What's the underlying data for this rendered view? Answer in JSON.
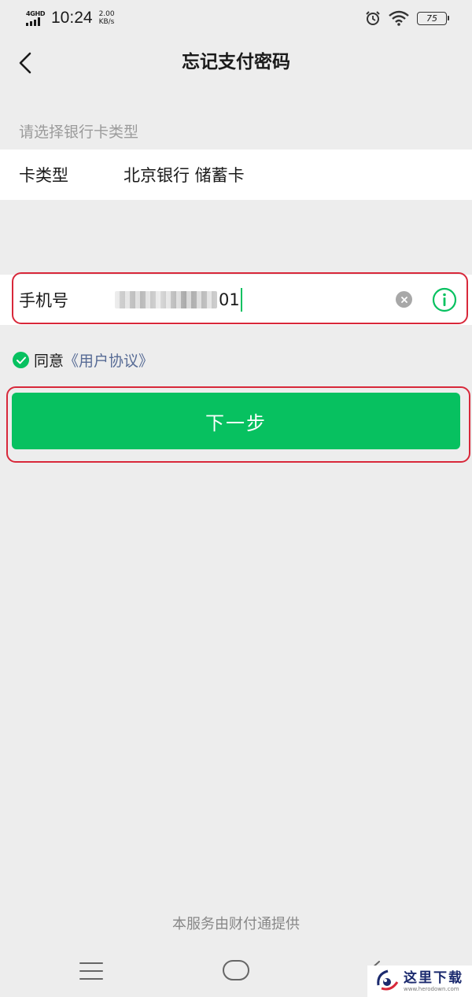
{
  "status_bar": {
    "network_type": "4GHD",
    "time": "10:24",
    "speed_value": "2.00",
    "speed_unit": "KB/s",
    "battery": "75",
    "icons": [
      "alarm-icon",
      "wifi-icon",
      "battery-icon"
    ]
  },
  "nav": {
    "title": "忘记支付密码",
    "back_icon": "chevron-left-icon"
  },
  "form": {
    "section_label": "请选择银行卡类型",
    "card_type": {
      "label": "卡类型",
      "value": "北京银行 储蓄卡"
    },
    "phone": {
      "label": "手机号",
      "value_visible_suffix": "01",
      "clear_icon": "clear-icon",
      "info_icon": "info-icon"
    }
  },
  "agreement": {
    "prefix": "同意",
    "link": "《用户协议》"
  },
  "next_button": {
    "label": "下一步"
  },
  "footer": {
    "text": "本服务由财付通提供"
  },
  "watermark": {
    "title": "这里下载",
    "url": "www.herodown.com"
  },
  "colors": {
    "accent": "#07c160",
    "link": "#576b95",
    "highlight": "#d8283a",
    "background": "#ededed"
  }
}
